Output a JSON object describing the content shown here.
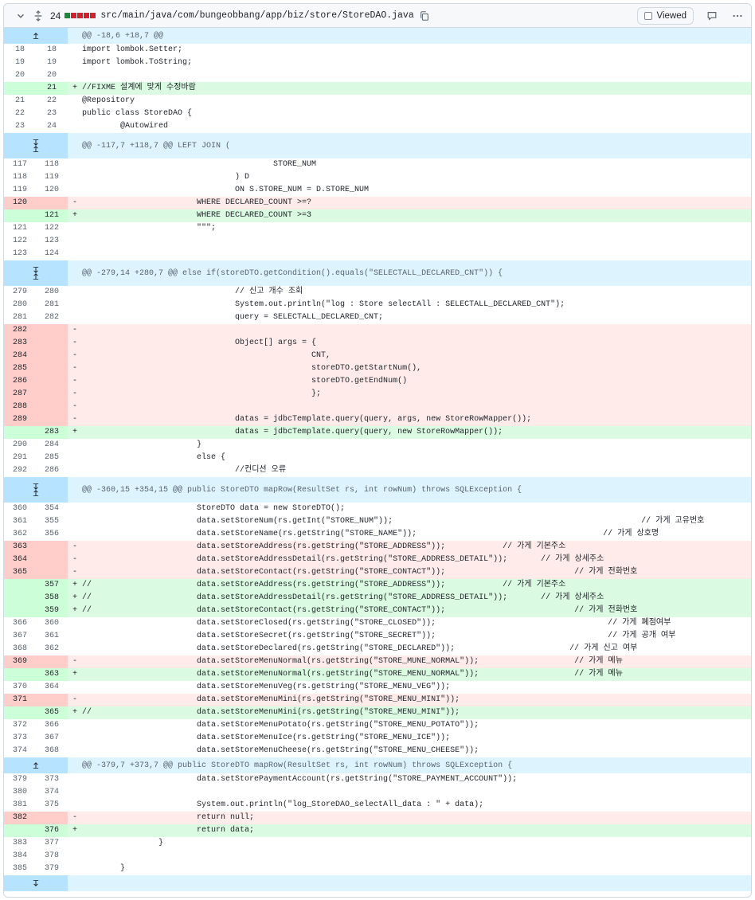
{
  "header": {
    "changes_count": "24",
    "diffstat_colors": [
      "#1f883d",
      "#cf222e",
      "#cf222e",
      "#cf222e",
      "#cf222e"
    ],
    "file_path": "src/main/java/com/bungeobbang/app/biz/store/StoreDAO.java",
    "viewed_label": "Viewed"
  },
  "icons": {
    "collapse": "chevron-down-icon",
    "expand_all": "unfold-icon",
    "copy": "copy-icon",
    "comment": "comment-icon",
    "more": "kebab-horizontal-icon",
    "expand_up": "fold-up-icon",
    "expand_down": "fold-down-icon"
  },
  "colors": {
    "deleted_bg": "#ffebe9",
    "deleted_gutter": "#ffcecb",
    "added_bg": "#dafbe1",
    "added_gutter": "#ccffd8",
    "hunk_bg": "#ddf4ff"
  },
  "hunks": [
    {
      "header": "@@ -18,6 +18,7 @@",
      "expand": "up",
      "lines": [
        {
          "t": "ctx",
          "o": "18",
          "n": "18",
          "s": "",
          "c": "import lombok.Setter;"
        },
        {
          "t": "ctx",
          "o": "19",
          "n": "19",
          "s": "",
          "c": "import lombok.ToString;"
        },
        {
          "t": "ctx",
          "o": "20",
          "n": "20",
          "s": "",
          "c": ""
        },
        {
          "t": "add",
          "o": "",
          "n": "21",
          "s": "+",
          "c": "//FIXME 설계에 맞게 수정바람"
        },
        {
          "t": "ctx",
          "o": "21",
          "n": "22",
          "s": "",
          "c": "@Repository"
        },
        {
          "t": "ctx",
          "o": "22",
          "n": "23",
          "s": "",
          "c": "public class StoreDAO {"
        },
        {
          "t": "ctx",
          "o": "23",
          "n": "24",
          "s": "",
          "c": "        @Autowired"
        }
      ]
    },
    {
      "header": "@@ -117,7 +118,7 @@ LEFT JOIN (",
      "expand": "both",
      "lines": [
        {
          "t": "ctx",
          "o": "117",
          "n": "118",
          "s": "",
          "c": "                                        STORE_NUM"
        },
        {
          "t": "ctx",
          "o": "118",
          "n": "119",
          "s": "",
          "c": "                                ) D"
        },
        {
          "t": "ctx",
          "o": "119",
          "n": "120",
          "s": "",
          "c": "                                ON S.STORE_NUM = D.STORE_NUM"
        },
        {
          "t": "del",
          "o": "120",
          "n": "",
          "s": "-",
          "c": "                        WHERE DECLARED_COUNT >=?"
        },
        {
          "t": "add",
          "o": "",
          "n": "121",
          "s": "+",
          "c": "                        WHERE DECLARED_COUNT >=3"
        },
        {
          "t": "ctx",
          "o": "121",
          "n": "122",
          "s": "",
          "c": "                        \"\"\";"
        },
        {
          "t": "ctx",
          "o": "122",
          "n": "123",
          "s": "",
          "c": ""
        },
        {
          "t": "ctx",
          "o": "123",
          "n": "124",
          "s": "",
          "c": ""
        }
      ]
    },
    {
      "header": "@@ -279,14 +280,7 @@ else if(storeDTO.getCondition().equals(\"SELECTALL_DECLARED_CNT\")) {",
      "expand": "both",
      "lines": [
        {
          "t": "ctx",
          "o": "279",
          "n": "280",
          "s": "",
          "c": "                                // 신고 개수 조회"
        },
        {
          "t": "ctx",
          "o": "280",
          "n": "281",
          "s": "",
          "c": "                                System.out.println(\"log : Store selectAll : SELECTALL_DECLARED_CNT\");"
        },
        {
          "t": "ctx",
          "o": "281",
          "n": "282",
          "s": "",
          "c": "                                query = SELECTALL_DECLARED_CNT;"
        },
        {
          "t": "del",
          "o": "282",
          "n": "",
          "s": "-",
          "c": ""
        },
        {
          "t": "del",
          "o": "283",
          "n": "",
          "s": "-",
          "c": "                                Object[] args = {"
        },
        {
          "t": "del",
          "o": "284",
          "n": "",
          "s": "-",
          "c": "                                                CNT,"
        },
        {
          "t": "del",
          "o": "285",
          "n": "",
          "s": "-",
          "c": "                                                storeDTO.getStartNum(),"
        },
        {
          "t": "del",
          "o": "286",
          "n": "",
          "s": "-",
          "c": "                                                storeDTO.getEndNum()"
        },
        {
          "t": "del",
          "o": "287",
          "n": "",
          "s": "-",
          "c": "                                                };"
        },
        {
          "t": "del",
          "o": "288",
          "n": "",
          "s": "-",
          "c": ""
        },
        {
          "t": "del",
          "o": "289",
          "n": "",
          "s": "-",
          "c": "                                datas = jdbcTemplate.query(query, args, new StoreRowMapper());"
        },
        {
          "t": "add",
          "o": "",
          "n": "283",
          "s": "+",
          "c": "                                datas = jdbcTemplate.query(query, new StoreRowMapper());"
        },
        {
          "t": "ctx",
          "o": "290",
          "n": "284",
          "s": "",
          "c": "                        }"
        },
        {
          "t": "ctx",
          "o": "291",
          "n": "285",
          "s": "",
          "c": "                        else {"
        },
        {
          "t": "ctx",
          "o": "292",
          "n": "286",
          "s": "",
          "c": "                                //컨디션 오류"
        }
      ]
    },
    {
      "header": "@@ -360,15 +354,15 @@ public StoreDTO mapRow(ResultSet rs, int rowNum) throws SQLException {",
      "expand": "both",
      "lines": [
        {
          "t": "ctx",
          "o": "360",
          "n": "354",
          "s": "",
          "c": "                        StoreDTO data = new StoreDTO();"
        },
        {
          "t": "ctx",
          "o": "361",
          "n": "355",
          "s": "",
          "c": "                        data.setStoreNum(rs.getInt(\"STORE_NUM\"));                                                    // 가게 고유번호"
        },
        {
          "t": "ctx",
          "o": "362",
          "n": "356",
          "s": "",
          "c": "                        data.setStoreName(rs.getString(\"STORE_NAME\"));                                       // 가게 상호명"
        },
        {
          "t": "del",
          "o": "363",
          "n": "",
          "s": "-",
          "c": "                        data.setStoreAddress(rs.getString(\"STORE_ADDRESS\"));            // 가게 기본주소"
        },
        {
          "t": "del",
          "o": "364",
          "n": "",
          "s": "-",
          "c": "                        data.setStoreAddressDetail(rs.getString(\"STORE_ADDRESS_DETAIL\"));       // 가게 상세주소"
        },
        {
          "t": "del",
          "o": "365",
          "n": "",
          "s": "-",
          "c": "                        data.setStoreContact(rs.getString(\"STORE_CONTACT\"));                           // 가게 전화번호"
        },
        {
          "t": "add",
          "o": "",
          "n": "357",
          "s": "+",
          "c": "//                      data.setStoreAddress(rs.getString(\"STORE_ADDRESS\"));            // 가게 기본주소"
        },
        {
          "t": "add",
          "o": "",
          "n": "358",
          "s": "+",
          "c": "//                      data.setStoreAddressDetail(rs.getString(\"STORE_ADDRESS_DETAIL\"));       // 가게 상세주소"
        },
        {
          "t": "add",
          "o": "",
          "n": "359",
          "s": "+",
          "c": "//                      data.setStoreContact(rs.getString(\"STORE_CONTACT\"));                           // 가게 전화번호"
        },
        {
          "t": "ctx",
          "o": "366",
          "n": "360",
          "s": "",
          "c": "                        data.setStoreClosed(rs.getString(\"STORE_CLOSED\"));                                    // 가게 폐점여부"
        },
        {
          "t": "ctx",
          "o": "367",
          "n": "361",
          "s": "",
          "c": "                        data.setStoreSecret(rs.getString(\"STORE_SECRET\"));                                    // 가게 공개 여부"
        },
        {
          "t": "ctx",
          "o": "368",
          "n": "362",
          "s": "",
          "c": "                        data.setStoreDeclared(rs.getString(\"STORE_DECLARED\"));                        // 가게 신고 여부"
        },
        {
          "t": "del",
          "o": "369",
          "n": "",
          "s": "-",
          "c": "                        data.setStoreMenuNormal(rs.getString(\"STORE_MUNE_NORMAL\"));                    // 가게 메뉴"
        },
        {
          "t": "add",
          "o": "",
          "n": "363",
          "s": "+",
          "c": "                        data.setStoreMenuNormal(rs.getString(\"STORE_MENU_NORMAL\"));                    // 가게 메뉴"
        },
        {
          "t": "ctx",
          "o": "370",
          "n": "364",
          "s": "",
          "c": "                        data.setStoreMenuVeg(rs.getString(\"STORE_MENU_VEG\"));"
        },
        {
          "t": "del",
          "o": "371",
          "n": "",
          "s": "-",
          "c": "                        data.setStoreMenuMini(rs.getString(\"STORE_MENU_MINI\"));"
        },
        {
          "t": "add",
          "o": "",
          "n": "365",
          "s": "+",
          "c": "//                      data.setStoreMenuMini(rs.getString(\"STORE_MENU_MINI\"));"
        },
        {
          "t": "ctx",
          "o": "372",
          "n": "366",
          "s": "",
          "c": "                        data.setStoreMenuPotato(rs.getString(\"STORE_MENU_POTATO\"));"
        },
        {
          "t": "ctx",
          "o": "373",
          "n": "367",
          "s": "",
          "c": "                        data.setStoreMenuIce(rs.getString(\"STORE_MENU_ICE\"));"
        },
        {
          "t": "ctx",
          "o": "374",
          "n": "368",
          "s": "",
          "c": "                        data.setStoreMenuCheese(rs.getString(\"STORE_MENU_CHEESE\"));"
        }
      ]
    },
    {
      "header": "@@ -379,7 +373,7 @@ public StoreDTO mapRow(ResultSet rs, int rowNum) throws SQLException {",
      "expand": "up",
      "lines": [
        {
          "t": "ctx",
          "o": "379",
          "n": "373",
          "s": "",
          "c": "                        data.setStorePaymentAccount(rs.getString(\"STORE_PAYMENT_ACCOUNT\"));"
        },
        {
          "t": "ctx",
          "o": "380",
          "n": "374",
          "s": "",
          "c": ""
        },
        {
          "t": "ctx",
          "o": "381",
          "n": "375",
          "s": "",
          "c": "                        System.out.println(\"log_StoreDAO_selectAll_data : \" + data);"
        },
        {
          "t": "del",
          "o": "382",
          "n": "",
          "s": "-",
          "c": "                        return null;"
        },
        {
          "t": "add",
          "o": "",
          "n": "376",
          "s": "+",
          "c": "                        return data;"
        },
        {
          "t": "ctx",
          "o": "383",
          "n": "377",
          "s": "",
          "c": "                }"
        },
        {
          "t": "ctx",
          "o": "384",
          "n": "378",
          "s": "",
          "c": ""
        },
        {
          "t": "ctx",
          "o": "385",
          "n": "379",
          "s": "",
          "c": "        }"
        }
      ]
    }
  ],
  "footer_expand": "down"
}
